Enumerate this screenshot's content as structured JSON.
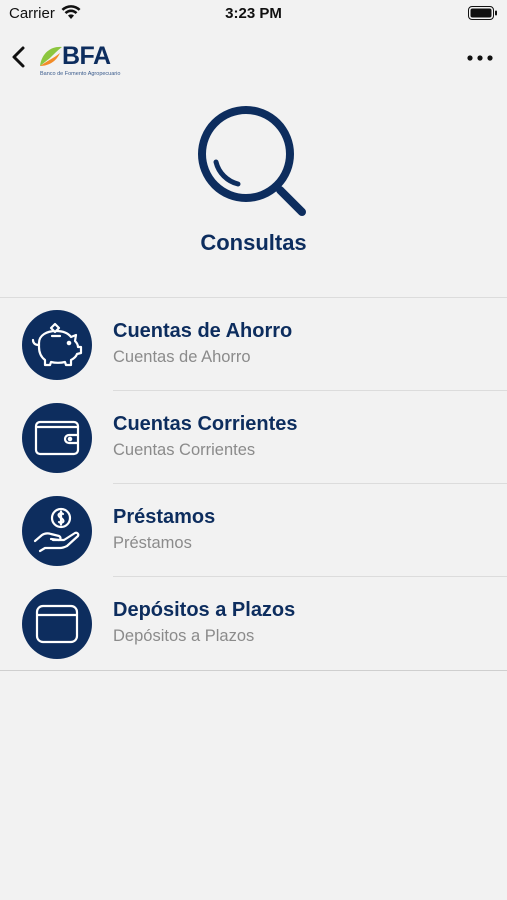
{
  "status_bar": {
    "carrier": "Carrier",
    "time": "3:23 PM"
  },
  "nav": {
    "logo_text": "BFA",
    "logo_subtitle": "Banco de Fomento Agropecuario",
    "back_icon": "chevron-left-icon",
    "more_icon": "more-horizontal-icon"
  },
  "header": {
    "icon": "search-icon",
    "title": "Consultas"
  },
  "menu": {
    "items": [
      {
        "title": "Cuentas de Ahorro",
        "subtitle": "Cuentas de Ahorro",
        "icon": "piggy-bank-icon"
      },
      {
        "title": "Cuentas Corrientes",
        "subtitle": "Cuentas Corrientes",
        "icon": "wallet-icon"
      },
      {
        "title": "Préstamos",
        "subtitle": "Préstamos",
        "icon": "hand-coin-icon"
      },
      {
        "title": "Depósitos a Plazos",
        "subtitle": "Depósitos a Plazos",
        "icon": "card-icon"
      }
    ]
  },
  "colors": {
    "primary": "#0d2d5e",
    "background": "#f2f2f2",
    "subtitle": "#8b8b8b",
    "logo_green": "#8cc63f",
    "logo_orange": "#f28c28"
  }
}
